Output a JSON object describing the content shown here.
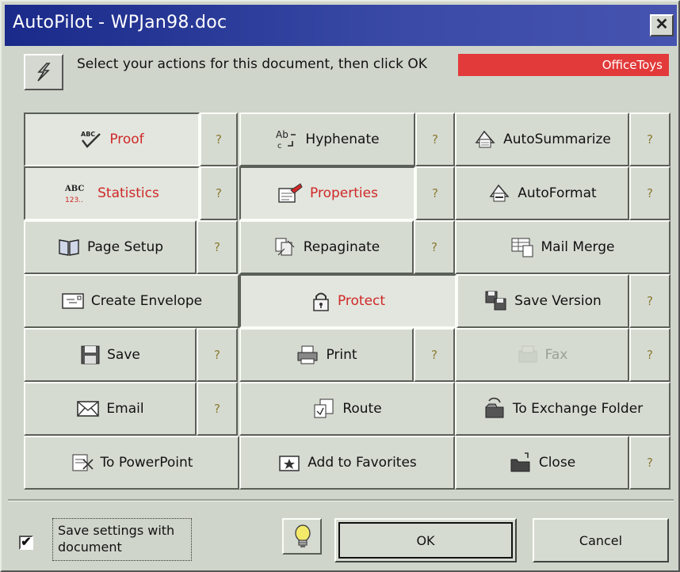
{
  "window": {
    "title": "AutoPilot - WPJan98.doc",
    "close_glyph": "✕"
  },
  "header": {
    "instruction": "Select your actions for this document, then click OK",
    "brand": "OfficeToys",
    "brand_color": "#e23a3a"
  },
  "help_label": "?",
  "buttons": [
    {
      "label": "Proof",
      "icon": "spellcheck-icon",
      "state": "pressed",
      "color": "red"
    },
    {
      "label": "Hyphenate",
      "icon": "hyphenate-icon"
    },
    {
      "label": "AutoSummarize",
      "icon": "autosummarize-icon"
    },
    {
      "label": "Statistics",
      "icon": "statistics-icon",
      "state": "pressed",
      "color": "red"
    },
    {
      "label": "Properties",
      "icon": "properties-icon",
      "state": "pressed",
      "color": "red"
    },
    {
      "label": "AutoFormat",
      "icon": "autoformat-icon"
    },
    {
      "label": "Page Setup",
      "icon": "book-icon"
    },
    {
      "label": "Repaginate",
      "icon": "repaginate-icon"
    },
    {
      "label": "Mail Merge",
      "icon": "mail-merge-icon"
    },
    {
      "label": "Create Envelope",
      "icon": "envelope-icon"
    },
    {
      "label": "Protect",
      "icon": "lock-icon",
      "state": "pressed",
      "color": "red"
    },
    {
      "label": "Save Version",
      "icon": "save-version-icon"
    },
    {
      "label": "Save",
      "icon": "floppy-disk-icon"
    },
    {
      "label": "Print",
      "icon": "printer-icon"
    },
    {
      "label": "Fax",
      "icon": "fax-icon",
      "state": "disabled"
    },
    {
      "label": "Email",
      "icon": "email-icon"
    },
    {
      "label": "Route",
      "icon": "route-icon"
    },
    {
      "label": "To Exchange Folder",
      "icon": "exchange-folder-icon"
    },
    {
      "label": "To PowerPoint",
      "icon": "powerpoint-icon"
    },
    {
      "label": "Add to Favorites",
      "icon": "favorites-folder-icon"
    },
    {
      "label": "Close",
      "icon": "close-folder-icon"
    }
  ],
  "footer": {
    "save_settings_label": "Save settings with document",
    "save_settings_checked": true,
    "checkmark": "✔",
    "tip_icon": "lightbulb-icon",
    "ok_label": "OK",
    "cancel_label": "Cancel"
  },
  "colors": {
    "title_bar": "#1a2a8a",
    "dialog_bg": "#cfd5cb",
    "active_text": "#d02828"
  }
}
